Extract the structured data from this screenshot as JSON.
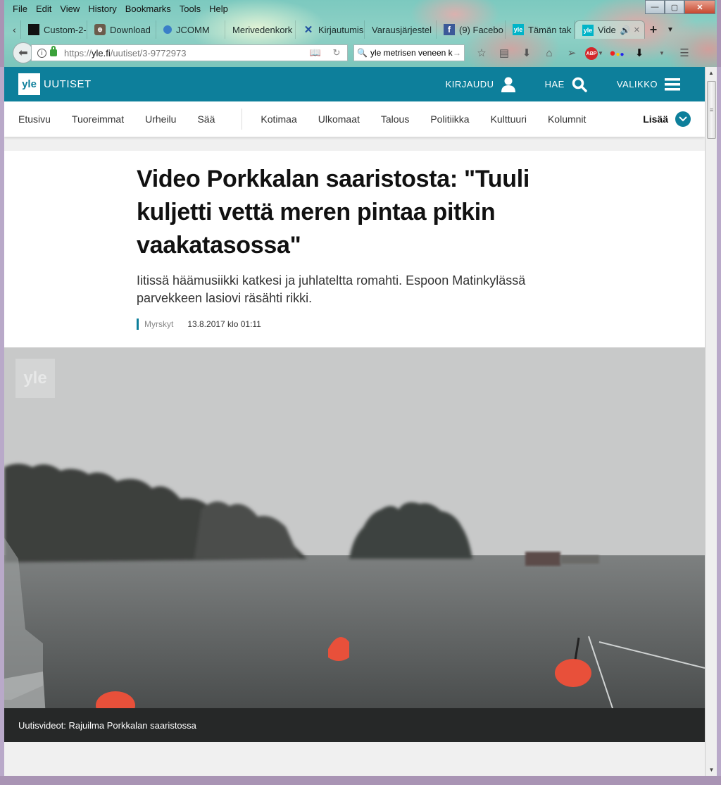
{
  "browser": {
    "menu": [
      "File",
      "Edit",
      "View",
      "History",
      "Bookmarks",
      "Tools",
      "Help"
    ],
    "window_controls": {
      "minimize": "—",
      "maximize": "▢",
      "close": "✕"
    },
    "tabs": [
      {
        "label": "Custom-2-",
        "icon": "custom-favicon",
        "color": "#111111"
      },
      {
        "label": "Download",
        "icon": "download-favicon",
        "color": "#6b5b4b"
      },
      {
        "label": "JCOMM",
        "icon": "jcomm-favicon",
        "color": "#3a7ec8"
      },
      {
        "label": "Merivedenkork",
        "icon": "",
        "color": ""
      },
      {
        "label": "Kirjautumis",
        "icon": "x-favicon",
        "color": "#1f4fa0"
      },
      {
        "label": "Varausjärjestel",
        "icon": "",
        "color": ""
      },
      {
        "label": "(9) Facebo",
        "icon": "facebook-favicon",
        "color": "#3b5998"
      },
      {
        "label": "Tämän tak",
        "icon": "yle-favicon",
        "color": "#00b4c8"
      },
      {
        "label": "Vide",
        "icon": "yle-favicon",
        "color": "#00b4c8",
        "active": true,
        "audio": true
      }
    ],
    "new_tab": "+",
    "url": {
      "prefix": "https://",
      "domain": "yle.fi",
      "path": "/uutiset/3-9772973"
    },
    "search_value": "yle metrisen veneen k"
  },
  "site": {
    "logo": "yle",
    "brand": "UUTISET",
    "header_actions": [
      {
        "label": "KIRJAUDU",
        "icon": "user-icon"
      },
      {
        "label": "HAE",
        "icon": "search-icon"
      },
      {
        "label": "VALIKKO",
        "icon": "menu-icon"
      }
    ],
    "nav_primary": [
      "Etusivu",
      "Tuoreimmat",
      "Urheilu",
      "Sää"
    ],
    "nav_secondary": [
      "Kotimaa",
      "Ulkomaat",
      "Talous",
      "Politiikka",
      "Kulttuuri",
      "Kolumnit"
    ],
    "nav_more": "Lisää",
    "accent_color": "#0d7f9b"
  },
  "article": {
    "headline": "Video Porkkalan saaristosta: \"Tuuli kuljetti vettä meren pintaa pitkin vaakatasossa\"",
    "lead": "Iitissä häämusiikki katkesi ja juhlateltta romahti. Espoon Matinkylässä parvekkeen lasiovi räsähti rikki.",
    "tag": "Myrskyt",
    "date": "13.8.2017 klo 01:11"
  },
  "video": {
    "watermark": "yle",
    "caption": "Uutisvideot: Rajuilma Porkkalan saaristossa"
  }
}
